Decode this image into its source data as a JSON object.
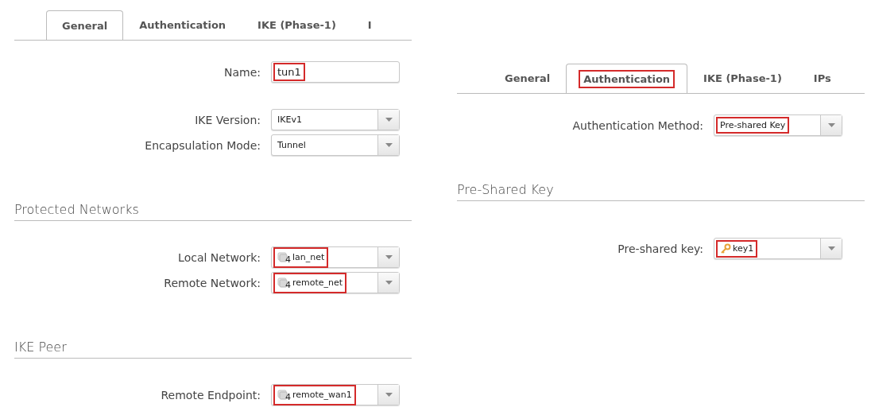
{
  "panels": [
    {
      "tabs": [
        {
          "label": "General",
          "selected": true,
          "highlighted": false
        },
        {
          "label": "Authentication",
          "selected": false,
          "highlighted": false
        },
        {
          "label": "IKE (Phase-1)",
          "selected": false,
          "highlighted": false
        },
        {
          "label": "I",
          "selected": false,
          "highlighted": false
        }
      ],
      "groups": [
        [
          {
            "label": "Name:",
            "kind": "text",
            "value": "tun1",
            "highlighted": true
          }
        ],
        [
          {
            "label": "IKE Version:",
            "kind": "select",
            "value": "IKEv1",
            "highlighted": false
          },
          {
            "label": "Encapsulation Mode:",
            "kind": "select",
            "value": "Tunnel",
            "highlighted": false
          }
        ]
      ],
      "sections": [
        {
          "title": "Protected Networks",
          "groups": [
            [
              {
                "label": "Local Network:",
                "kind": "network-select",
                "badge": "4",
                "value": "lan_net",
                "highlighted": true
              },
              {
                "label": "Remote Network:",
                "kind": "network-select",
                "badge": "4",
                "value": "remote_net",
                "highlighted": true
              }
            ]
          ]
        },
        {
          "title": "IKE Peer",
          "groups": [
            [
              {
                "label": "Remote Endpoint:",
                "kind": "network-select",
                "badge": "4",
                "value": "remote_wan1",
                "highlighted": true
              }
            ]
          ]
        }
      ]
    },
    {
      "tabs": [
        {
          "label": "General",
          "selected": false,
          "highlighted": false
        },
        {
          "label": "Authentication",
          "selected": true,
          "highlighted": true
        },
        {
          "label": "IKE (Phase-1)",
          "selected": false,
          "highlighted": false
        },
        {
          "label": "IPs",
          "selected": false,
          "highlighted": false
        }
      ],
      "groups": [
        [
          {
            "label": "Authentication Method:",
            "kind": "select",
            "value": "Pre-shared Key",
            "highlighted": true
          }
        ]
      ],
      "sections": [
        {
          "title": "Pre-Shared Key",
          "groups": [
            [
              {
                "label": "Pre-shared key:",
                "kind": "key-select",
                "value": "key1",
                "highlighted": true
              }
            ]
          ]
        }
      ]
    }
  ]
}
